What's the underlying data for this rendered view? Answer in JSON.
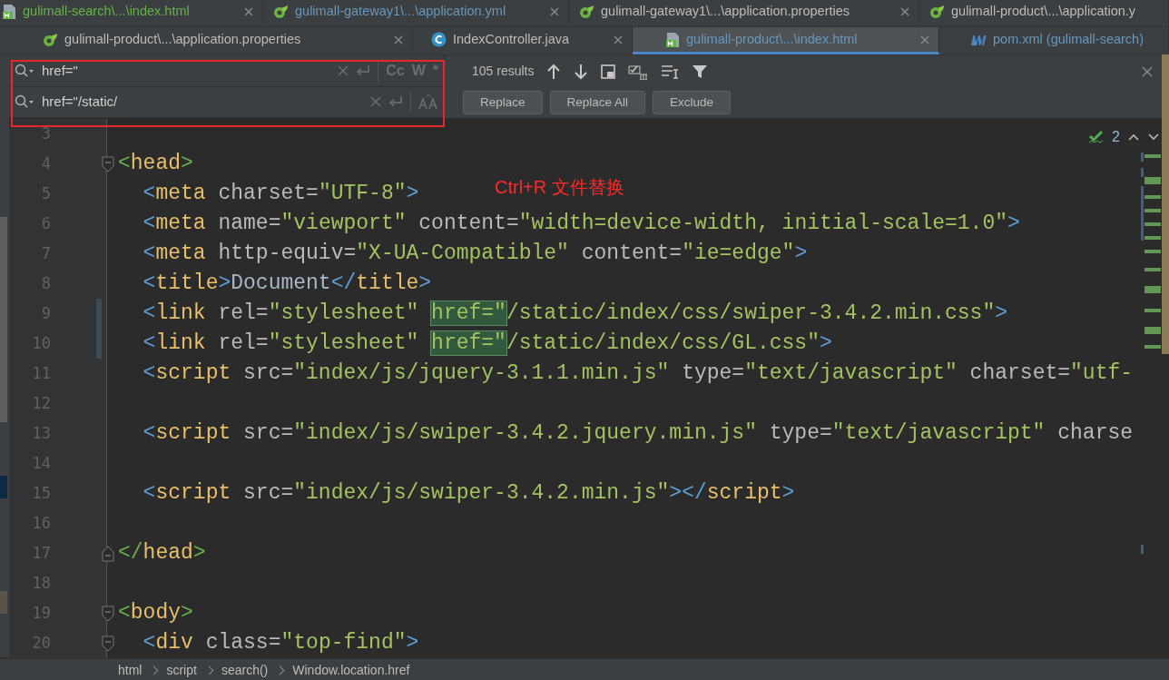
{
  "tab_rows": [
    {
      "tabs": [
        {
          "label": "gulimall-search\\...\\index.html",
          "kind": "html",
          "color": "#62b543",
          "selected": false,
          "closable": true
        },
        {
          "label": "gulimall-gateway1\\...\\application.yml",
          "kind": "spring",
          "color": "#6897bb",
          "selected": false,
          "closable": true
        },
        {
          "label": "gulimall-gateway1\\...\\application.properties",
          "kind": "spring",
          "color": "#bbbbbb",
          "selected": false,
          "closable": true
        },
        {
          "label": "gulimall-product\\...\\application.y",
          "kind": "spring",
          "color": "#bbbbbb",
          "selected": false,
          "closable": false
        }
      ]
    },
    {
      "tabs": [
        {
          "label": "gulimall-product\\...\\application.properties",
          "kind": "spring",
          "color": "#bbbbbb",
          "selected": false,
          "closable": true
        },
        {
          "label": "IndexController.java",
          "kind": "java",
          "color": "#bbbbbb",
          "selected": false,
          "closable": true
        },
        {
          "label": "gulimall-product\\...\\index.html",
          "kind": "html",
          "color": "#6897bb",
          "selected": true,
          "closable": true
        },
        {
          "label": "pom.xml (gulimall-search)",
          "kind": "maven",
          "color": "#6897bb",
          "selected": false,
          "closable": false
        }
      ]
    }
  ],
  "find_bar": {
    "search": {
      "value": "href=\"",
      "options": [
        {
          "label": "Cc",
          "on": false
        },
        {
          "label": "W",
          "on": false
        },
        {
          "label": "*",
          "on": false
        }
      ]
    },
    "replace": {
      "value": "href=\"/static/"
    },
    "results": "105 results",
    "buttons": [
      "Replace",
      "Replace All",
      "Exclude"
    ]
  },
  "annotation": "Ctrl+R 文件替换",
  "inspection": {
    "count": "2"
  },
  "editor_lines": [
    {
      "number": "3",
      "kind": "plain",
      "changed": false
    },
    {
      "number": "4",
      "kind": "opener",
      "changed": false,
      "segments": [
        {
          "text": "<",
          "kind": "outer-bracket"
        },
        {
          "text": "head",
          "kind": "tag"
        },
        {
          "text": ">",
          "kind": "outer-bracket"
        }
      ]
    },
    {
      "number": "5",
      "kind": "plain",
      "changed": false,
      "segments": [
        {
          "text": "  <",
          "kind": "inner-bracket"
        },
        {
          "text": "meta",
          "kind": "tag"
        },
        {
          "text": " charset=",
          "kind": "attr"
        },
        {
          "text": "\"UTF-8\"",
          "kind": "value"
        },
        {
          "text": ">",
          "kind": "inner-bracket"
        }
      ]
    },
    {
      "number": "6",
      "kind": "plain",
      "changed": false,
      "segments": [
        {
          "text": "  <",
          "kind": "inner-bracket"
        },
        {
          "text": "meta",
          "kind": "tag"
        },
        {
          "text": " name=",
          "kind": "attr"
        },
        {
          "text": "\"viewport\"",
          "kind": "value"
        },
        {
          "text": " content=",
          "kind": "attr"
        },
        {
          "text": "\"width=device-width, initial-scale=1.0\"",
          "kind": "value"
        },
        {
          "text": ">",
          "kind": "inner-bracket"
        }
      ]
    },
    {
      "number": "7",
      "kind": "plain",
      "changed": false,
      "segments": [
        {
          "text": "  <",
          "kind": "inner-bracket"
        },
        {
          "text": "meta",
          "kind": "tag"
        },
        {
          "text": " http-equiv=",
          "kind": "attr"
        },
        {
          "text": "\"X-UA-Compatible\"",
          "kind": "value"
        },
        {
          "text": " content=",
          "kind": "attr"
        },
        {
          "text": "\"ie=edge\"",
          "kind": "value"
        },
        {
          "text": ">",
          "kind": "inner-bracket"
        }
      ]
    },
    {
      "number": "8",
      "kind": "plain",
      "changed": false,
      "segments": [
        {
          "text": "  <",
          "kind": "inner-bracket"
        },
        {
          "text": "title",
          "kind": "tag"
        },
        {
          "text": ">",
          "kind": "inner-bracket"
        },
        {
          "text": "Document",
          "kind": "text"
        },
        {
          "text": "</",
          "kind": "inner-bracket"
        },
        {
          "text": "title",
          "kind": "tag"
        },
        {
          "text": ">",
          "kind": "inner-bracket"
        }
      ]
    },
    {
      "number": "9",
      "kind": "plain",
      "changed": true,
      "segments": [
        {
          "text": "  <",
          "kind": "inner-bracket"
        },
        {
          "text": "link",
          "kind": "tag"
        },
        {
          "text": " rel=",
          "kind": "attr"
        },
        {
          "text": "\"stylesheet\" ",
          "kind": "value"
        },
        {
          "text": "href=\"",
          "kind": "match"
        },
        {
          "text": "/static/index/css/swiper-3.4.2.min.css\"",
          "kind": "value"
        },
        {
          "text": ">",
          "kind": "inner-bracket"
        }
      ]
    },
    {
      "number": "10",
      "kind": "plain",
      "changed": true,
      "segments": [
        {
          "text": "  <",
          "kind": "inner-bracket"
        },
        {
          "text": "link",
          "kind": "tag"
        },
        {
          "text": " rel=",
          "kind": "attr"
        },
        {
          "text": "\"stylesheet\" ",
          "kind": "value"
        },
        {
          "text": "href=\"",
          "kind": "match"
        },
        {
          "text": "/static/index/css/GL.css\"",
          "kind": "value"
        },
        {
          "text": ">",
          "kind": "inner-bracket"
        }
      ]
    },
    {
      "number": "11",
      "kind": "plain",
      "changed": false,
      "segments": [
        {
          "text": "  <",
          "kind": "inner-bracket"
        },
        {
          "text": "script",
          "kind": "tag"
        },
        {
          "text": " src=",
          "kind": "attr"
        },
        {
          "text": "\"index/js/jquery-3.1.1.min.js\"",
          "kind": "value"
        },
        {
          "text": " type=",
          "kind": "attr"
        },
        {
          "text": "\"text/javascript\"",
          "kind": "value"
        },
        {
          "text": " charset=",
          "kind": "attr"
        },
        {
          "text": "\"utf-",
          "kind": "value"
        }
      ]
    },
    {
      "number": "12",
      "kind": "plain",
      "changed": false
    },
    {
      "number": "13",
      "kind": "plain",
      "changed": false,
      "segments": [
        {
          "text": "  <",
          "kind": "inner-bracket"
        },
        {
          "text": "script",
          "kind": "tag"
        },
        {
          "text": " src=",
          "kind": "attr"
        },
        {
          "text": "\"index/js/swiper-3.4.2.jquery.min.js\"",
          "kind": "value"
        },
        {
          "text": " type=",
          "kind": "attr"
        },
        {
          "text": "\"text/javascript\"",
          "kind": "value"
        },
        {
          "text": " charse",
          "kind": "attr"
        }
      ]
    },
    {
      "number": "14",
      "kind": "plain",
      "changed": false
    },
    {
      "number": "15",
      "kind": "plain",
      "changed": false,
      "segments": [
        {
          "text": "  <",
          "kind": "inner-bracket"
        },
        {
          "text": "script",
          "kind": "tag"
        },
        {
          "text": " src=",
          "kind": "attr"
        },
        {
          "text": "\"index/js/swiper-3.4.2.min.js\"",
          "kind": "value"
        },
        {
          "text": "></",
          "kind": "inner-bracket"
        },
        {
          "text": "script",
          "kind": "tag"
        },
        {
          "text": ">",
          "kind": "inner-bracket"
        }
      ]
    },
    {
      "number": "16",
      "kind": "plain",
      "changed": false
    },
    {
      "number": "17",
      "kind": "closer",
      "changed": false,
      "segments": [
        {
          "text": "</",
          "kind": "outer-bracket"
        },
        {
          "text": "head",
          "kind": "tag"
        },
        {
          "text": ">",
          "kind": "outer-bracket"
        }
      ]
    },
    {
      "number": "18",
      "kind": "plain",
      "changed": false
    },
    {
      "number": "19",
      "kind": "opener",
      "changed": false,
      "segments": [
        {
          "text": "<",
          "kind": "outer-bracket"
        },
        {
          "text": "body",
          "kind": "tag"
        },
        {
          "text": ">",
          "kind": "outer-bracket"
        }
      ]
    },
    {
      "number": "20",
      "kind": "opener",
      "changed": false,
      "segments": [
        {
          "text": "  <",
          "kind": "inner-bracket"
        },
        {
          "text": "div",
          "kind": "tag"
        },
        {
          "text": " class=",
          "kind": "attr"
        },
        {
          "text": "\"top-find\"",
          "kind": "value"
        },
        {
          "text": ">",
          "kind": "inner-bracket"
        }
      ]
    }
  ],
  "breadcrumb": [
    "html",
    "script",
    "search()",
    "Window.location.href"
  ]
}
